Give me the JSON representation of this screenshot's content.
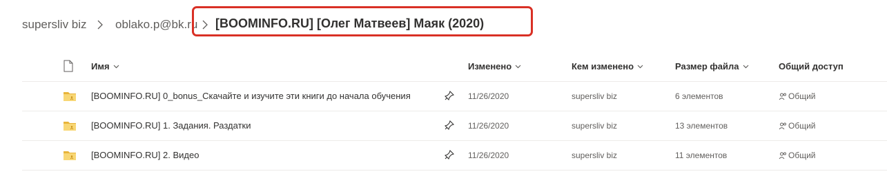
{
  "breadcrumb": {
    "items": [
      "supersliv biz",
      "oblako.p@bk.ru"
    ],
    "current": "[BOOMINFO.RU] [Олег Матвеев] Маяк (2020)"
  },
  "columns": {
    "name": "Имя",
    "modified": "Изменено",
    "modified_by": "Кем изменено",
    "file_size": "Размер файла",
    "sharing": "Общий доступ"
  },
  "rows": [
    {
      "name": "[BOOMINFO.RU] 0_bonus_Скачайте и изучите эти книги до начала обучения",
      "modified": "11/26/2020",
      "modified_by": "supersliv biz",
      "size": "6 элементов",
      "sharing": "Общий"
    },
    {
      "name": "[BOOMINFO.RU] 1. Задания. Раздатки",
      "modified": "11/26/2020",
      "modified_by": "supersliv biz",
      "size": "13 элементов",
      "sharing": "Общий"
    },
    {
      "name": "[BOOMINFO.RU] 2. Видео",
      "modified": "11/26/2020",
      "modified_by": "supersliv biz",
      "size": "11 элементов",
      "sharing": "Общий"
    }
  ],
  "colors": {
    "highlight": "#d93025",
    "folder": "#f8d775",
    "folder_dark": "#e8b43a"
  },
  "icons": [
    "chevron-right-icon",
    "file-icon",
    "chevron-down-icon",
    "folder-icon",
    "pin-icon",
    "people-icon"
  ]
}
